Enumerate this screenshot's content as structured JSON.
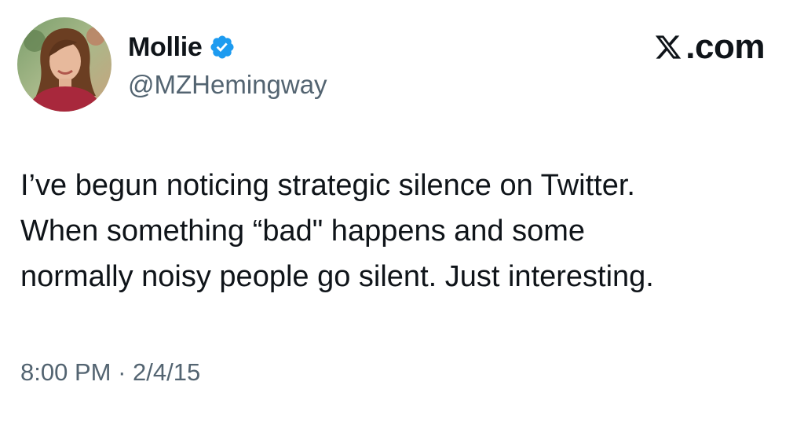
{
  "author": {
    "name": "Mollie",
    "handle": "@MZHemingway",
    "verified": true,
    "avatar_icon": "profile-photo"
  },
  "brand": {
    "logo_icon": "x-logo-icon",
    "domain": ".com"
  },
  "tweet": {
    "lines": [
      "I’ve begun noticing strategic silence on Twitter.",
      "When something “bad\" happens and some",
      "normally noisy people go silent. Just interesting."
    ]
  },
  "meta": {
    "time": "8:00 PM",
    "separator": " · ",
    "date": "2/4/15"
  },
  "colors": {
    "text": "#0f1419",
    "secondary": "#536471",
    "verified_blue": "#1d9bf0",
    "background": "#ffffff"
  }
}
